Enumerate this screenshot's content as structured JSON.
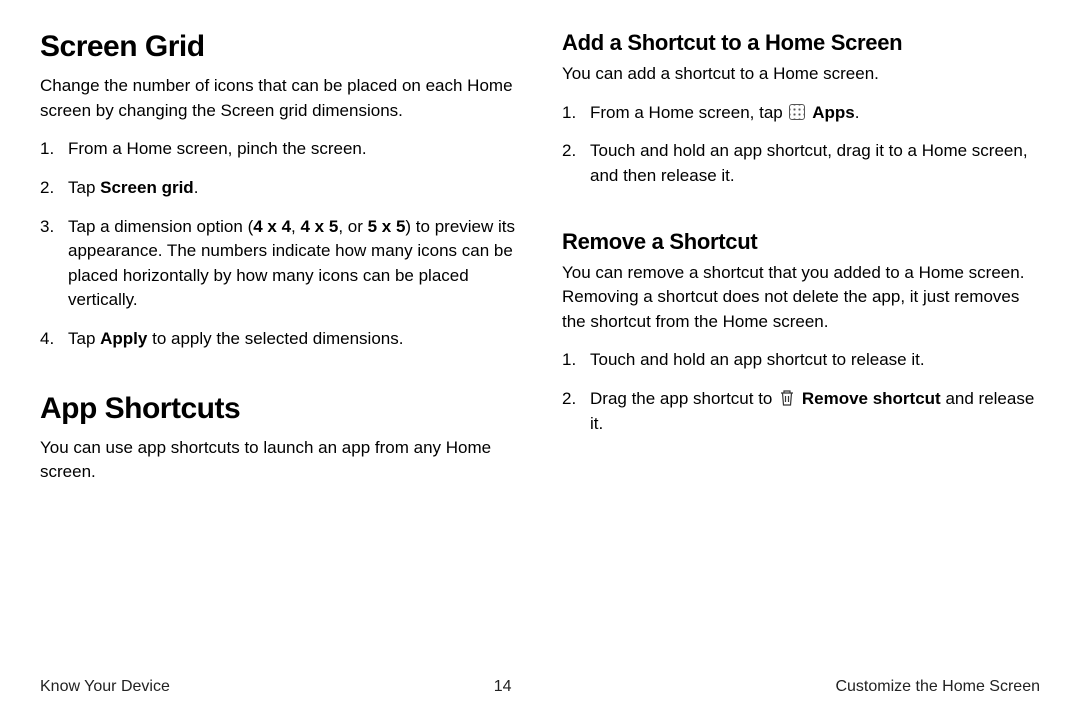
{
  "left": {
    "h1a": "Screen Grid",
    "p1": "Change the number of icons that can be placed on each Home screen by changing the Screen grid dimensions.",
    "steps_a": {
      "s1": "From a Home screen, pinch the screen.",
      "s2_pre": "Tap ",
      "s2_b": "Screen grid",
      "s2_post": ".",
      "s3_pre": "Tap a dimension option (",
      "s3_b1": "4 x 4",
      "s3_mid1": ", ",
      "s3_b2": "4 x 5",
      "s3_mid2": ", or ",
      "s3_b3": "5 x 5",
      "s3_post": ") to preview its appearance. The numbers indicate how many icons can be placed horizontally by how many icons can be placed vertically.",
      "s4_pre": "Tap ",
      "s4_b": "Apply",
      "s4_post": " to apply the selected dimensions."
    },
    "h1b": "App Shortcuts",
    "p2": "You can use app shortcuts to launch an app from any Home screen."
  },
  "right": {
    "h2a": "Add a Shortcut to a Home Screen",
    "p1": "You can add a shortcut to a Home screen.",
    "add_steps": {
      "s1_pre": "From a Home screen, tap ",
      "s1_b": "Apps",
      "s1_post": ".",
      "s2": "Touch and hold an app shortcut, drag it to a Home screen, and then release it."
    },
    "h2b": "Remove a Shortcut",
    "p2": "You can remove a shortcut that you added to a Home screen. Removing a shortcut does not delete the app, it just removes the shortcut from the Home screen.",
    "rem_steps": {
      "s1": "Touch and hold an app shortcut to release it.",
      "s2_pre": "Drag the app shortcut to ",
      "s2_b": "Remove shortcut",
      "s2_post": " and release it."
    }
  },
  "footer": {
    "left": "Know Your Device",
    "page": "14",
    "right": "Customize the Home Screen"
  }
}
